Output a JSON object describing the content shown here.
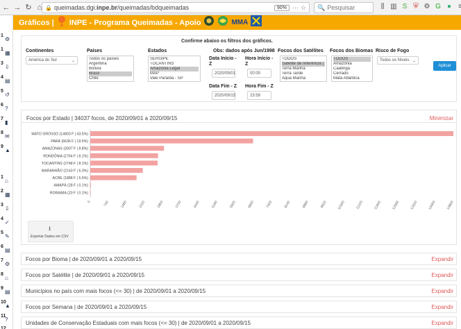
{
  "browser": {
    "back_icon": "back-arrow-icon",
    "forward_icon": "forward-arrow-icon",
    "reload_icon": "reload-icon",
    "home_icon": "home-icon",
    "url_prefix": "queimadas.dgi.",
    "url_domain": "inpe.br",
    "url_path": "/queimadas/bdqueimadas",
    "zoom": "90%",
    "search_placeholder": "Pesquisar",
    "dots": "···",
    "star": "☆"
  },
  "sidebar": {
    "items": [
      {
        "num": "1",
        "icon": "⚙"
      },
      {
        "num": "1",
        "icon": "▦"
      },
      {
        "num": "3",
        "icon": "⇩"
      },
      {
        "num": "4",
        "icon": "▤"
      },
      {
        "num": "5",
        "icon": "↺"
      },
      {
        "num": "6",
        "icon": "?"
      },
      {
        "num": "7",
        "icon": "▮"
      },
      {
        "num": "8",
        "icon": "✉"
      },
      {
        "num": "9",
        "icon": "▲"
      },
      {
        "num": "1",
        "icon": "⌂"
      },
      {
        "num": "2",
        "icon": "▦"
      },
      {
        "num": "3",
        "icon": "⇩"
      },
      {
        "num": "4",
        "icon": "✓"
      },
      {
        "num": "5",
        "icon": "✎"
      },
      {
        "num": "6",
        "icon": "▤"
      },
      {
        "num": "7",
        "icon": "⚙"
      },
      {
        "num": "8",
        "icon": "⌂"
      },
      {
        "num": "9",
        "icon": "▤"
      },
      {
        "num": "10",
        "icon": "▲"
      },
      {
        "num": "11",
        "icon": "?"
      },
      {
        "num": "12",
        "icon": "▦"
      }
    ]
  },
  "header": {
    "title": "Gráficos |",
    "program": "INPE - Programa Queimadas - Apoio",
    "mma": "MMA"
  },
  "filters": {
    "title": "Confirme abaixo os filtros dos gráficos.",
    "continentes_label": "Continentes",
    "continente_value": "América do Sul",
    "paises_label": "Países",
    "paises": [
      "Todos os países",
      "Argentina",
      "Bolivia",
      "Brasil",
      "Chile"
    ],
    "estados_label": "Estados",
    "estados": [
      "SERGIPE",
      "TOCANTINS",
      "Amazônia Legal",
      "MAP",
      "Vale Paraíba - SP"
    ],
    "obs": "Obs: dados após Jun/1998",
    "data_inicio_label": "Data Início - Z",
    "data_inicio": "2020/09/01",
    "hora_inicio_label": "Hora Início - Z",
    "hora_inicio": "00:00",
    "data_fim_label": "Data Fim - Z",
    "data_fim": "2020/09/15",
    "hora_fim_label": "Hora Fim - Z",
    "hora_fim": "23:59",
    "satelites_label": "Focos dos Satélites",
    "satelites": [
      "TODOS",
      "Satélite de referência (",
      "Terra Manhã",
      "Terra Tarde",
      "Aqua Manhã"
    ],
    "biomas_label": "Focos dos Biomas",
    "biomas": [
      "TODOS",
      "Amazônia",
      "Caatinga",
      "Cerrado",
      "Mata Atlântica"
    ],
    "risco_label": "Risco de Fogo",
    "risco_value": "Todos os Níveis",
    "apply": "Aplicar"
  },
  "estado_panel": {
    "title": "Focos por Estado | 34037 focos, de 2020/09/01 a 2020/09/15",
    "minimizar": "Minimizar",
    "export": "Exportar Dados em CSV"
  },
  "chart_data": {
    "type": "bar",
    "orientation": "horizontal",
    "categories": [
      "MATO GROSSO (14803 F | 43.5%)",
      "PARÁ (6636 F | 19.5%)",
      "AMAZONAS (3007 F | 8.8%)",
      "RONDÔNIA (2764 F | 8.1%)",
      "TOCANTINS (2748 F | 8.1%)",
      "MARANHÃO (2143 F | 6.3%)",
      "ACRE (1888 F | 5.5%)",
      "AMAPÁ (28 F | 0.1%)",
      "RORAIMA (20 F | 0.1%)"
    ],
    "values": [
      14803,
      6636,
      3007,
      2764,
      2748,
      2143,
      1888,
      28,
      20
    ],
    "xlim": [
      0,
      14803
    ],
    "ticks": [
      "0",
      "740",
      "1480",
      "2220",
      "2960",
      "3700",
      "4440",
      "5180",
      "5920",
      "6660",
      "7400",
      "8140",
      "8880",
      "9620",
      "10360",
      "11100",
      "11840",
      "12580",
      "13320",
      "14060",
      "14800"
    ],
    "bar_color": "#f2a3a1",
    "grid": false
  },
  "panels": [
    {
      "title": "Focos por Bioma | de 2020/09/01 a 2020/09/15",
      "action": "Expandir"
    },
    {
      "title": "Focos por Satélite | de 2020/09/01 a 2020/09/15",
      "action": "Expandir"
    },
    {
      "title": "Municípios no país com mais focos (<= 30) | de 2020/09/01 a 2020/09/15",
      "action": "Expandir"
    },
    {
      "title": "Focos por Semana | de 2020/09/01 a 2020/09/15",
      "action": "Expandir"
    },
    {
      "title": "Unidades de Conservação Estaduais com mais focos (<= 30) | de 2020/09/01 a 2020/09/15",
      "action": "Expandir"
    }
  ]
}
